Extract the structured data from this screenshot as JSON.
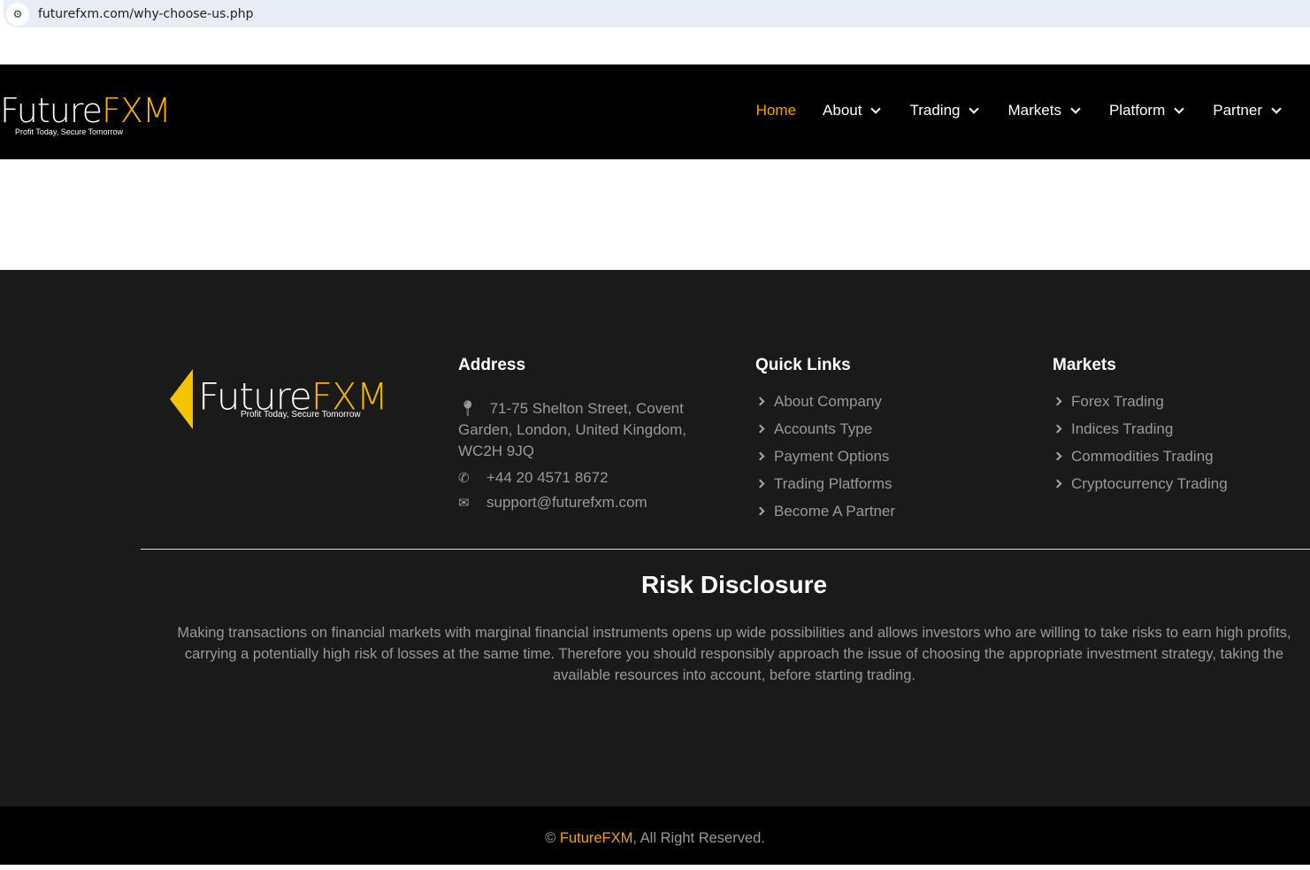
{
  "browser": {
    "url": "futurefxm.com/why-choose-us.php"
  },
  "brand": {
    "name_white": "Future",
    "name_yellow": "FXM",
    "tagline": "Profit Today, Secure Tomorrow"
  },
  "nav": [
    "Home",
    "About",
    "Trading",
    "Markets",
    "Platform",
    "Partner"
  ],
  "footer": {
    "address": {
      "title": "Address",
      "street": "71-75 Shelton Street, Covent Garden, London, United Kingdom, WC2H 9JQ",
      "phone": "+44 20 4571 8672",
      "email": "support@futurefxm.com"
    },
    "quick_links": {
      "title": "Quick Links",
      "items": [
        "About Company",
        "Accounts Type",
        "Payment Options",
        "Trading Platforms",
        "Become A Partner"
      ]
    },
    "markets": {
      "title": "Markets",
      "items": [
        "Forex Trading",
        "Indices Trading",
        "Commodities Trading",
        "Cryptocurrency Trading"
      ]
    },
    "risk": {
      "title": "Risk Disclosure",
      "text": "Making transactions on financial markets with marginal financial instruments opens up wide possibilities and allows investors who are willing to take risks to earn high profits, carrying a potentially high risk of losses at the same time. Therefore you should responsibly approach the issue of choosing the appropriate investment strategy, taking the available resources into account, before starting trading."
    },
    "copyright": {
      "symbol": "©",
      "brand": "FutureFXM",
      "rest": ", All Right Reserved."
    }
  }
}
